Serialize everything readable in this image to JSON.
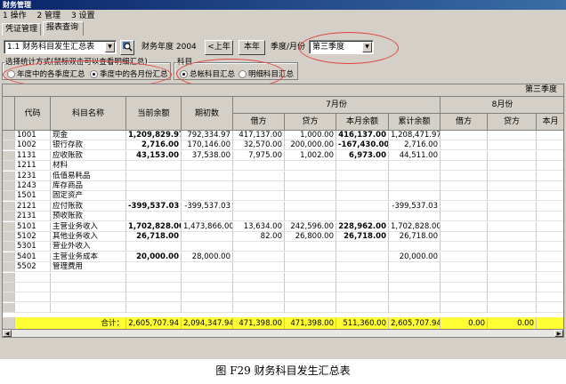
{
  "window": {
    "title": "财务管理"
  },
  "menu": [
    "1 操作",
    "2 管理",
    "3 设置"
  ],
  "tabs": [
    "凭证管理",
    "报表查询"
  ],
  "toolbar": {
    "report_select": "1.1 财务科目发生汇总表",
    "fiscal_year_label": "财务年度 2004",
    "prev_year": "<上年",
    "this_year": "本年",
    "period_label": "季度/月份",
    "period_select": "第三季度"
  },
  "stat_group": {
    "legend": "选择统计方式(鼠标双击可以查看明细汇总)",
    "opt1": "年度中的各季度汇总",
    "opt2": "季度中的各月份汇总",
    "opt2_selected": true
  },
  "subject_group": {
    "legend": "科目",
    "opt1": "总帐科目汇总",
    "opt2": "明细科目汇总",
    "opt1_selected": true
  },
  "table": {
    "quarter_header": "第三季度",
    "month1": "7月份",
    "month2": "8月份",
    "cols": [
      "代码",
      "科目名称",
      "当前余额",
      "期初数",
      "借方",
      "贷方",
      "本月余额",
      "累计余额",
      "借方",
      "贷方",
      "本月"
    ],
    "rows": [
      [
        "1001",
        "现金",
        "1,209,829.97",
        "792,334.97",
        "417,137.00",
        "1,000.00",
        "416,137.00",
        "1,208,471.97"
      ],
      [
        "1002",
        "银行存款",
        "2,716.00",
        "170,146.00",
        "32,570.00",
        "200,000.00",
        "-167,430.00",
        "2,716.00"
      ],
      [
        "1131",
        "应收账款",
        "43,153.00",
        "37,538.00",
        "7,975.00",
        "1,002.00",
        "6,973.00",
        "44,511.00"
      ],
      [
        "1211",
        "材料",
        "",
        "",
        "",
        "",
        "",
        ""
      ],
      [
        "1231",
        "低值易耗品",
        "",
        "",
        "",
        "",
        "",
        ""
      ],
      [
        "1243",
        "库存商品",
        "",
        "",
        "",
        "",
        "",
        ""
      ],
      [
        "1501",
        "固定资产",
        "",
        "",
        "",
        "",
        "",
        ""
      ],
      [
        "2121",
        "应付账款",
        "-399,537.03",
        "-399,537.03",
        "",
        "",
        "",
        "-399,537.03"
      ],
      [
        "2131",
        "预收账款",
        "",
        "",
        "",
        "",
        "",
        ""
      ],
      [
        "5101",
        "主营业务收入",
        "1,702,828.00",
        "1,473,866.00",
        "13,634.00",
        "242,596.00",
        "228,962.00",
        "1,702,828.00"
      ],
      [
        "5102",
        "其他业务收入",
        "26,718.00",
        "",
        "82.00",
        "26,800.00",
        "26,718.00",
        "26,718.00"
      ],
      [
        "5301",
        "营业外收入",
        "",
        "",
        "",
        "",
        "",
        ""
      ],
      [
        "5401",
        "主营业务成本",
        "20,000.00",
        "28,000.00",
        "",
        "",
        "",
        "20,000.00"
      ],
      [
        "5502",
        "管理费用",
        "",
        "",
        "",
        "",
        "",
        ""
      ]
    ],
    "total": [
      "合计：",
      "2,605,707.94",
      "2,094,347.94",
      "471,398.00",
      "471,398.00",
      "511,360.00",
      "2,605,707.94",
      "0.00",
      "0.00"
    ]
  },
  "caption": "图 F29 财务科目发生汇总表"
}
